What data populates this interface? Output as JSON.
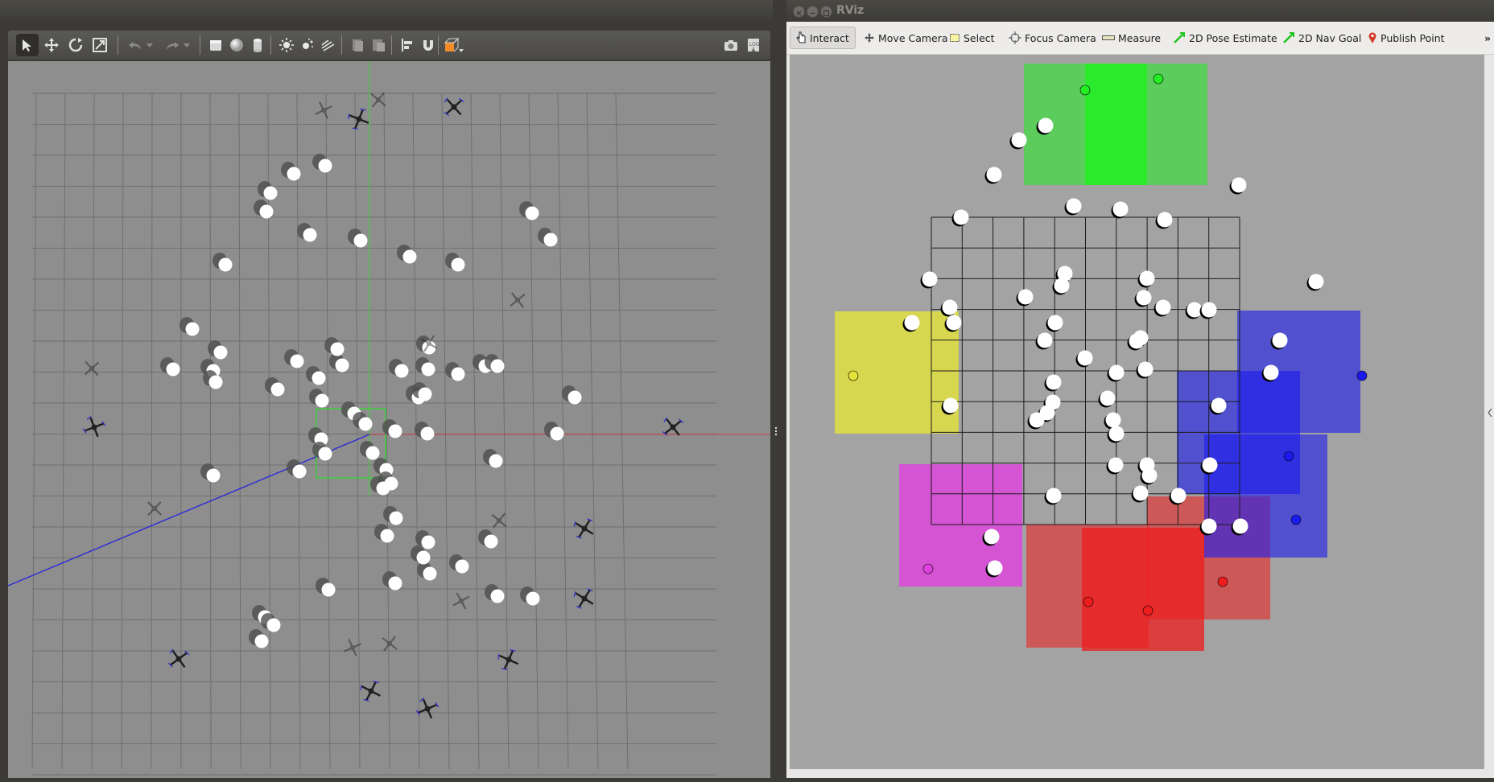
{
  "gazebo": {
    "toolbar": {
      "tools": [
        "select-tool",
        "translate-tool",
        "rotate-tool",
        "scale-tool",
        "undo",
        "undo-dropdown",
        "redo",
        "redo-dropdown",
        "box-shape",
        "sphere-shape",
        "cylinder-shape",
        "sun-light",
        "point-light",
        "spot-light",
        "copy",
        "paste",
        "align",
        "snap",
        "change-view",
        "screenshot",
        "log"
      ]
    },
    "accent_colors": {
      "orange": "#f28c28",
      "blue_axis": "#1a1aff",
      "red_axis": "#d33",
      "green_axis": "#2ecc40"
    }
  },
  "rviz": {
    "window_title": "RViz",
    "toolbar": {
      "interact": "Interact",
      "move_camera": "Move Camera",
      "select": "Select",
      "focus_camera": "Focus Camera",
      "measure": "Measure",
      "pose_estimate": "2D Pose Estimate",
      "nav_goal": "2D Nav Goal",
      "publish_point": "Publish Point",
      "overflow": "»"
    },
    "region_colors": {
      "green": "#22ee22",
      "yellow": "#e2e23a",
      "magenta": "#e040e0",
      "red": "#ee1c1c",
      "blue": "#1a1aee"
    }
  }
}
